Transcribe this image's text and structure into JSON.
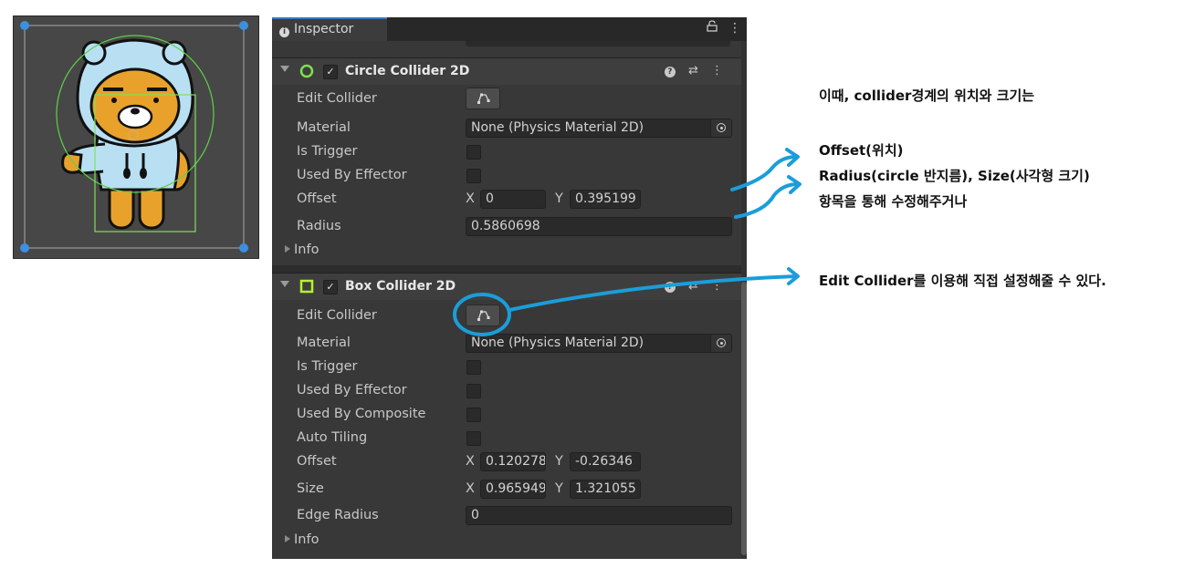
{
  "inspector": {
    "tab_label": "Inspector",
    "circle_collider": {
      "title": "Circle Collider 2D",
      "enabled_mark": "✓",
      "rows": {
        "edit_collider": "Edit Collider",
        "material": "Material",
        "material_value": "None (Physics Material 2D)",
        "is_trigger": "Is Trigger",
        "used_by_effector": "Used By Effector",
        "offset": "Offset",
        "offset_x_axis": "X",
        "offset_x": "0",
        "offset_y_axis": "Y",
        "offset_y": "0.395199",
        "radius": "Radius",
        "radius_value": "0.5860698",
        "info": "Info"
      }
    },
    "box_collider": {
      "title": "Box Collider 2D",
      "enabled_mark": "✓",
      "rows": {
        "edit_collider": "Edit Collider",
        "material": "Material",
        "material_value": "None (Physics Material 2D)",
        "is_trigger": "Is Trigger",
        "used_by_effector": "Used By Effector",
        "used_by_composite": "Used By Composite",
        "auto_tiling": "Auto Tiling",
        "offset": "Offset",
        "offset_x_axis": "X",
        "offset_x": "0.120278",
        "offset_y_axis": "Y",
        "offset_y": "-0.26346",
        "size": "Size",
        "size_x_axis": "X",
        "size_x": "0.965949",
        "size_y_axis": "Y",
        "size_y": "1.321055",
        "edge_radius": "Edge Radius",
        "edge_radius_value": "0",
        "info": "Info"
      }
    },
    "icons": [
      "info-icon",
      "lock-icon",
      "menu-dots-icon",
      "help-icon",
      "preset-icon",
      "circle-collider-icon",
      "box-collider-icon",
      "edit-collider-icon",
      "object-picker-icon"
    ]
  },
  "annotations": {
    "line1": "이때, collider경계의 위치와 크기는",
    "line2": "Offset(위치)",
    "line3": "Radius(circle 반지름), Size(사각형 크기)",
    "line4": "항목을 통해 수정해주거나",
    "line5": "Edit Collider를 이용해 직접 설정해줄 수 있다."
  },
  "colors": {
    "inspector_bg": "#383838",
    "field_bg": "#2a2a2a",
    "accent_tab": "#3a79bb",
    "circle_icon": "#7ee04a",
    "box_icon": "#b6f22e",
    "annotation_blue": "#1a9ed9",
    "scene_bg": "#474747"
  }
}
